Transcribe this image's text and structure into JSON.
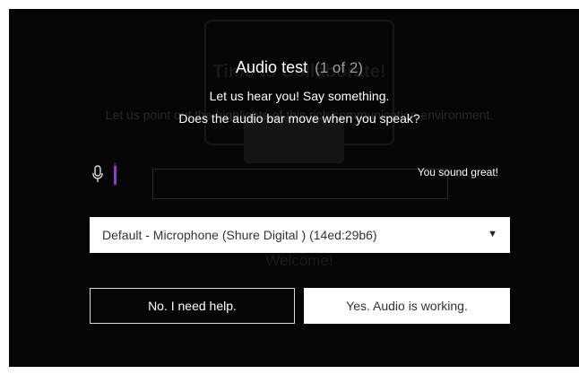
{
  "dialog": {
    "title": "Audio test",
    "step": "(1 of 2)",
    "prompt": "Let us hear you! Say something.",
    "question": "Does the audio bar move when you speak?",
    "status": "You sound great!",
    "audio_level": 0.85,
    "accent_color": "#8a3ec9",
    "mic_icon": "microphone-icon",
    "device_select": {
      "value": "Default - Microphone (Shure Digital ) (14ed:29b6)",
      "arrow_icon": "caret-down-icon"
    },
    "buttons": {
      "no_label": "No. I need help.",
      "yes_label": "Yes. Audio is working."
    }
  },
  "background_page": {
    "title": "Time to Collaborate!",
    "subtitle": "Let us point out the highlights of this rich communication environment.",
    "welcome": "Welcome!"
  }
}
